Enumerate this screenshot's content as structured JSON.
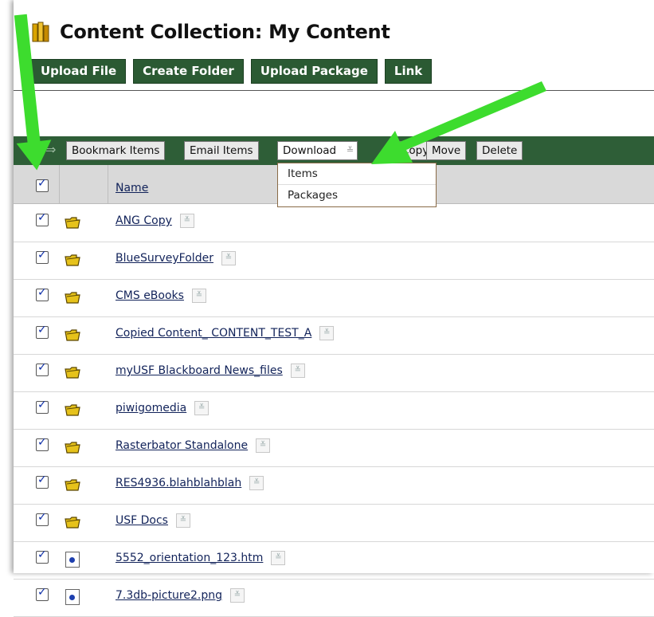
{
  "page_title": "Content Collection: My Content",
  "toolbar": {
    "buttons": [
      "Upload File",
      "Create Folder",
      "Upload Package",
      "Link"
    ]
  },
  "action_bar": {
    "bookmark": "Bookmark Items",
    "email": "Email Items",
    "download": "Download",
    "copy": "Copy",
    "move": "Move",
    "delete": "Delete"
  },
  "download_menu": {
    "items": [
      "Items",
      "Packages"
    ]
  },
  "table": {
    "header_name": "Name",
    "rows": [
      {
        "name": "ANG Copy",
        "type": "folder"
      },
      {
        "name": "BlueSurveyFolder",
        "type": "folder"
      },
      {
        "name": "CMS eBooks",
        "type": "folder"
      },
      {
        "name": "Copied Content_ CONTENT_TEST_A",
        "type": "folder"
      },
      {
        "name": "myUSF Blackboard News_files",
        "type": "folder"
      },
      {
        "name": "piwigomedia",
        "type": "folder"
      },
      {
        "name": "Rasterbator Standalone",
        "type": "folder"
      },
      {
        "name": "RES4936.blahblahblah",
        "type": "folder"
      },
      {
        "name": "USF Docs",
        "type": "folder"
      },
      {
        "name": "5552_orientation_123.htm",
        "type": "file"
      },
      {
        "name": "7.3db-picture2.png",
        "type": "image"
      }
    ]
  },
  "colors": {
    "accent_green": "#2b5a33",
    "callout_arrow": "#3ddc2e",
    "link": "#12235a"
  }
}
